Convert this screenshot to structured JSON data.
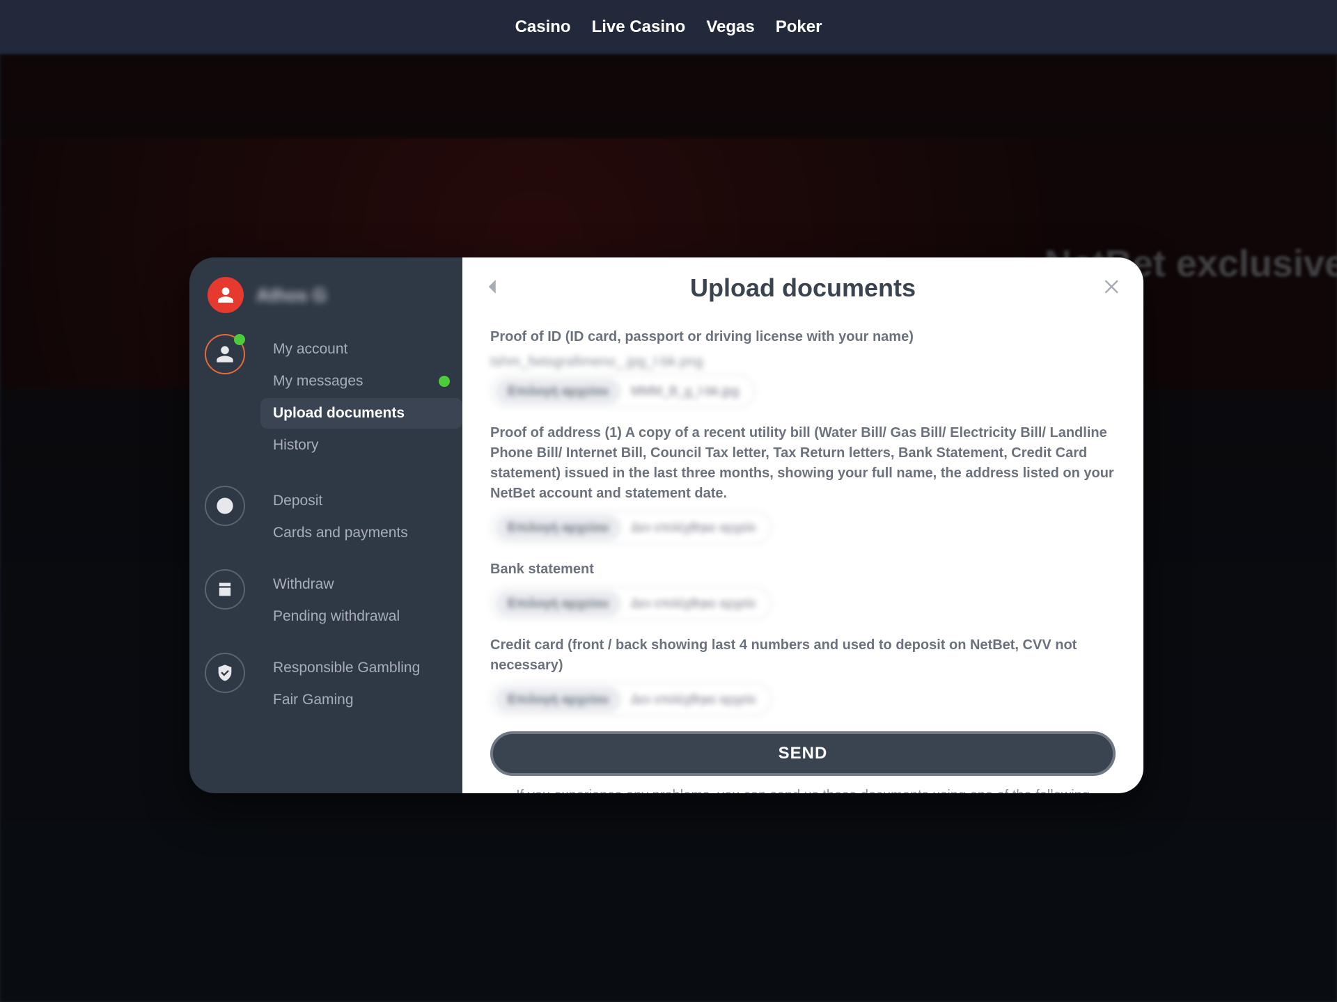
{
  "topnav": {
    "items": [
      "Casino",
      "Live Casino",
      "Vegas",
      "Poker"
    ]
  },
  "background": {
    "banner_text": "NetBet exclusive ti"
  },
  "sidebar": {
    "username": "Athos G",
    "groups": [
      {
        "icon": "user",
        "active": true,
        "badge": true,
        "items": [
          {
            "label": "My account",
            "active": false,
            "badge": false
          },
          {
            "label": "My messages",
            "active": false,
            "badge": true
          },
          {
            "label": "Upload documents",
            "active": true,
            "badge": false
          },
          {
            "label": "History",
            "active": false,
            "badge": false
          }
        ]
      },
      {
        "icon": "deposit",
        "active": false,
        "badge": false,
        "items": [
          {
            "label": "Deposit",
            "active": false,
            "badge": false
          },
          {
            "label": "Cards and payments",
            "active": false,
            "badge": false
          }
        ]
      },
      {
        "icon": "withdraw",
        "active": false,
        "badge": false,
        "items": [
          {
            "label": "Withdraw",
            "active": false,
            "badge": false
          },
          {
            "label": "Pending withdrawal",
            "active": false,
            "badge": false
          }
        ]
      },
      {
        "icon": "shield",
        "active": false,
        "badge": false,
        "items": [
          {
            "label": "Responsible Gambling",
            "active": false,
            "badge": false
          },
          {
            "label": "Fair Gaming",
            "active": false,
            "badge": false
          }
        ]
      }
    ]
  },
  "panel": {
    "title": "Upload documents",
    "proof_id_label": "Proof of ID (ID card, passport or driving license with your name)",
    "proof_address_label": "Proof of address (1) A copy of a recent utility bill (Water Bill/ Gas Bill/ Electricity Bill/ Landline Phone Bill/ Internet Bill, Council Tax letter, Tax Return letters, Bank Statement, Credit Card statement) issued in the last three months, showing your full name, the address listed on your NetBet account and statement date.",
    "bank_label": "Bank statement",
    "credit_label": "Credit card (front / back showing last 4 numbers and used to deposit on NetBet, CVV not necessary)",
    "file_chip": "Επιλογή αρχείου",
    "file_placeholder_a": "Δεν επιλέχθηκε αρχείο",
    "file_placeholder_b": "MMM_B_g_l-bk.jpg",
    "send": "SEND",
    "hint": "If you experience any problems, you can send us these documents using one of the following methods"
  }
}
